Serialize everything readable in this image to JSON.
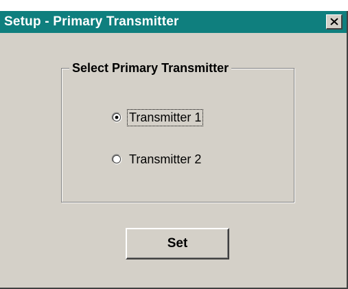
{
  "window": {
    "title": "Setup - Primary Transmitter",
    "close_icon": "close-icon",
    "title_bar_color": "#0f7f7e",
    "background_color": "#d4d0c8"
  },
  "group": {
    "legend": "Select Primary Transmitter",
    "options": [
      {
        "label": "Transmitter 1",
        "selected": true,
        "focused": true
      },
      {
        "label": "Transmitter 2",
        "selected": false,
        "focused": false
      }
    ]
  },
  "actions": {
    "set_label": "Set"
  }
}
